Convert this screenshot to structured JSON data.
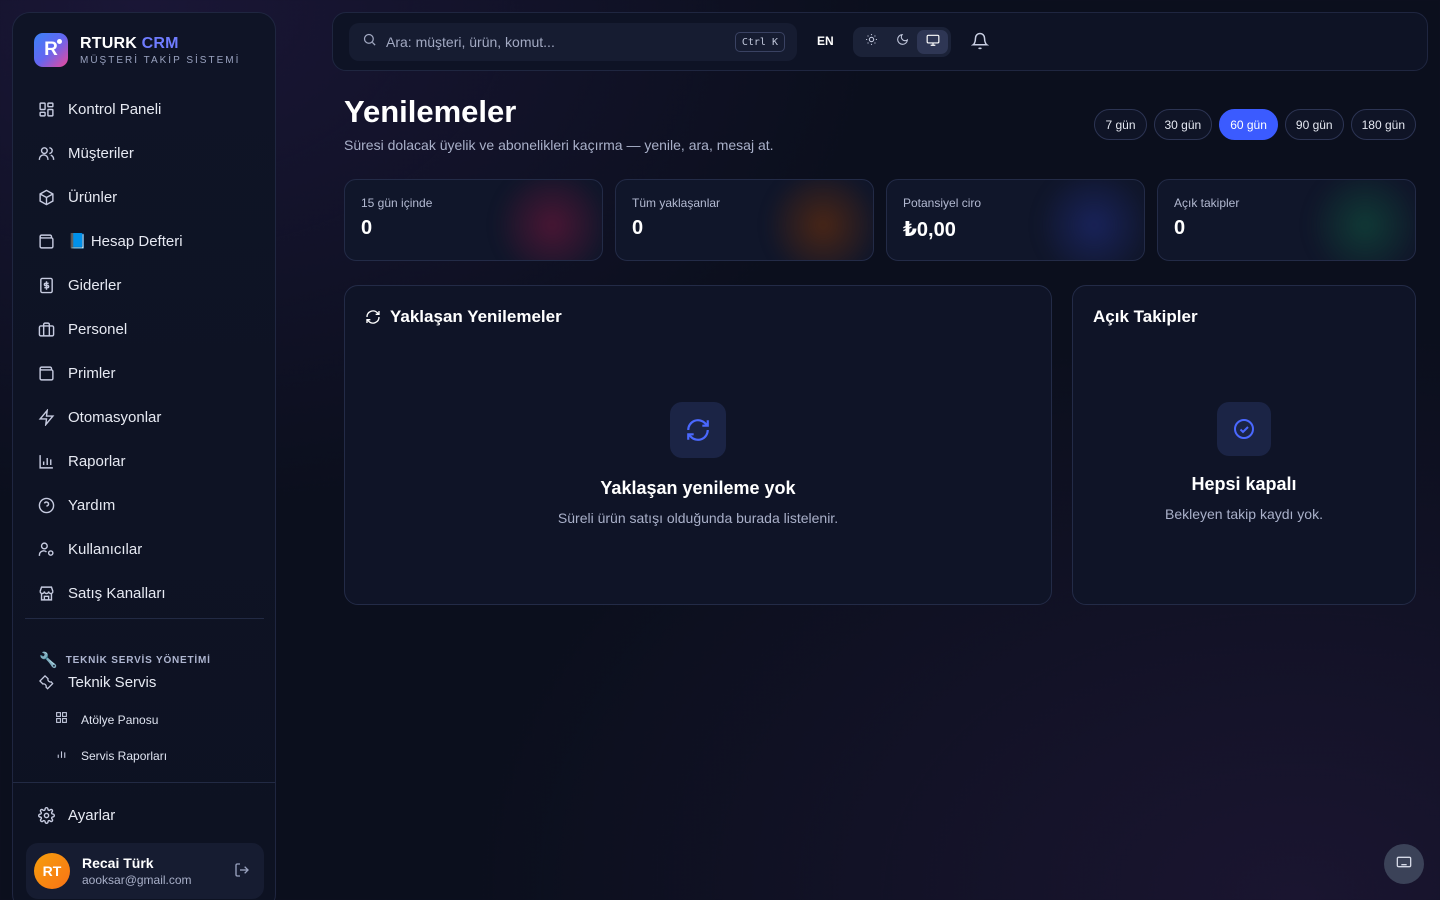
{
  "brand": {
    "name_main": "RTURK",
    "name_accent": "CRM",
    "subtitle": "MÜŞTERİ TAKİP SİSTEMİ",
    "logo_letter": "R"
  },
  "sidebar": {
    "items": [
      {
        "label": "Kontrol Paneli",
        "icon": "dashboard-icon"
      },
      {
        "label": "Müşteriler",
        "icon": "users-icon"
      },
      {
        "label": "Ürünler",
        "icon": "box-icon"
      },
      {
        "label": "📘 Hesap Defteri",
        "icon": "wallet-icon"
      },
      {
        "label": "Giderler",
        "icon": "receipt-icon"
      },
      {
        "label": "Personel",
        "icon": "briefcase-icon"
      },
      {
        "label": "Primler",
        "icon": "wallet-icon"
      },
      {
        "label": "Otomasyonlar",
        "icon": "zap-icon"
      },
      {
        "label": "Raporlar",
        "icon": "bar-chart-icon"
      },
      {
        "label": "Yardım",
        "icon": "help-icon"
      },
      {
        "label": "Kullanıcılar",
        "icon": "user-cog-icon"
      },
      {
        "label": "Satış Kanalları",
        "icon": "store-icon"
      }
    ],
    "section_title": "TEKNİK SERVİS YÖNETİMİ",
    "service_item": "Teknik Servis",
    "sub_items": [
      "Atölye Panosu",
      "Servis Raporları"
    ],
    "settings": "Ayarlar",
    "user": {
      "initials": "RT",
      "name": "Recai Türk",
      "email": "aooksar@gmail.com"
    }
  },
  "topbar": {
    "search_placeholder": "Ara: müşteri, ürün, komut...",
    "shortcut": "Ctrl K",
    "language": "EN",
    "theme_modes": [
      "light",
      "dark",
      "system"
    ],
    "theme_active": "system"
  },
  "page": {
    "title": "Yenilemeler",
    "subtitle": "Süresi dolacak üyelik ve abonelikleri kaçırma — yenile, ara, mesaj at.",
    "ranges": [
      "7 gün",
      "30 gün",
      "60 gün",
      "90 gün",
      "180 gün"
    ],
    "active_range": "60 gün"
  },
  "stats": [
    {
      "label": "15 gün içinde",
      "value": "0",
      "glow": "#5a1a3a"
    },
    {
      "label": "Tüm yaklaşanlar",
      "value": "0",
      "glow": "#5a2c1a"
    },
    {
      "label": "Potansiyel ciro",
      "value": "₺0,00",
      "glow": "#1a2560"
    },
    {
      "label": "Açık takipler",
      "value": "0",
      "glow": "#12403a"
    }
  ],
  "renewals_panel": {
    "title": "Yaklaşan Yenilemeler",
    "empty_title": "Yaklaşan yenileme yok",
    "empty_desc": "Süreli ürün satışı olduğunda burada listelenir."
  },
  "followups_panel": {
    "title": "Açık Takipler",
    "empty_title": "Hepsi kapalı",
    "empty_desc": "Bekleyen takip kaydı yok."
  }
}
